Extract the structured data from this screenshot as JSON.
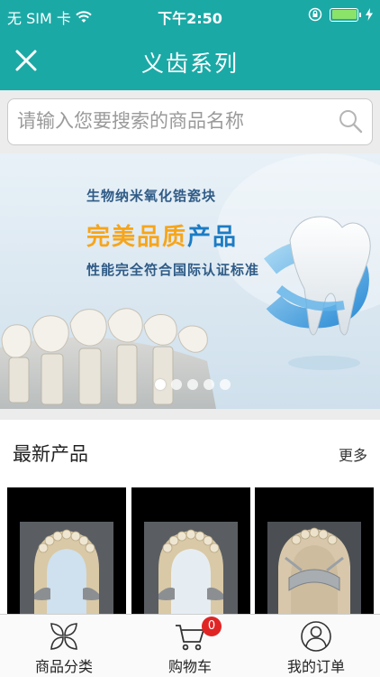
{
  "status_bar": {
    "carrier": "无 SIM 卡",
    "time": "下午2:50"
  },
  "nav": {
    "title": "义齿系列"
  },
  "search": {
    "placeholder": "请输入您要搜索的商品名称"
  },
  "banner": {
    "line1": "生物纳米氧化锆瓷块",
    "line2_yellow": "完美品质",
    "line2_blue": "产品",
    "line3": "性能完全符合国际认证标准",
    "slide_count": 5,
    "active_slide": 1
  },
  "section": {
    "title": "最新产品",
    "more": "更多"
  },
  "products": [
    {
      "image": "dental-cast-1"
    },
    {
      "image": "dental-cast-2"
    },
    {
      "image": "dental-framework-3"
    }
  ],
  "tabs": [
    {
      "label": "商品分类",
      "icon": "category-icon"
    },
    {
      "label": "购物车",
      "icon": "cart-icon",
      "badge": "0"
    },
    {
      "label": "我的订单",
      "icon": "user-icon"
    }
  ],
  "colors": {
    "primary": "#1ba9a6",
    "badge": "#e02424",
    "accent_yellow": "#f6a51b",
    "accent_blue": "#1c7cc4"
  }
}
